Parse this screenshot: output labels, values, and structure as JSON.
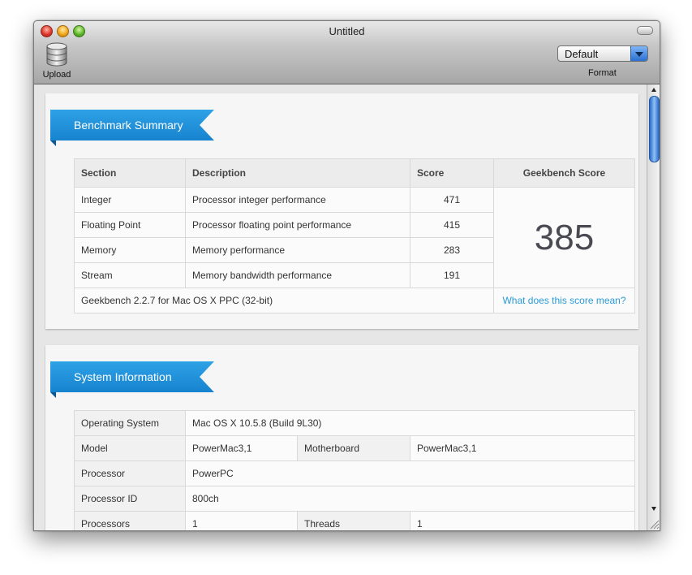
{
  "window": {
    "title": "Untitled"
  },
  "toolbar": {
    "upload_label": "Upload",
    "upload_icon": "database-icon",
    "format_value": "Default",
    "format_label": "Format",
    "accent": "#2a6fd1"
  },
  "benchmark": {
    "heading": "Benchmark Summary",
    "columns": [
      "Section",
      "Description",
      "Score",
      "Geekbench Score"
    ],
    "rows": [
      {
        "section": "Integer",
        "description": "Processor integer performance",
        "score": "471"
      },
      {
        "section": "Floating Point",
        "description": "Processor floating point performance",
        "score": "415"
      },
      {
        "section": "Memory",
        "description": "Memory performance",
        "score": "283"
      },
      {
        "section": "Stream",
        "description": "Memory bandwidth performance",
        "score": "191"
      }
    ],
    "geekbench_score": "385",
    "footer": "Geekbench 2.2.7 for Mac OS X PPC (32-bit)",
    "link": "What does this score mean?"
  },
  "system": {
    "heading": "System Information",
    "os_label": "Operating System",
    "os_value": "Mac OS X 10.5.8 (Build 9L30)",
    "model_label": "Model",
    "model_value": "PowerMac3,1",
    "motherboard_label": "Motherboard",
    "motherboard_value": "PowerMac3,1",
    "processor_label": "Processor",
    "processor_value": "PowerPC",
    "processor_id_label": "Processor ID",
    "processor_id_value": "800ch",
    "processors_label": "Processors",
    "processors_value": "1",
    "threads_label": "Threads",
    "threads_value": "1"
  },
  "colors": {
    "ribbon": "#1f90da",
    "link": "#2a9bd8"
  }
}
